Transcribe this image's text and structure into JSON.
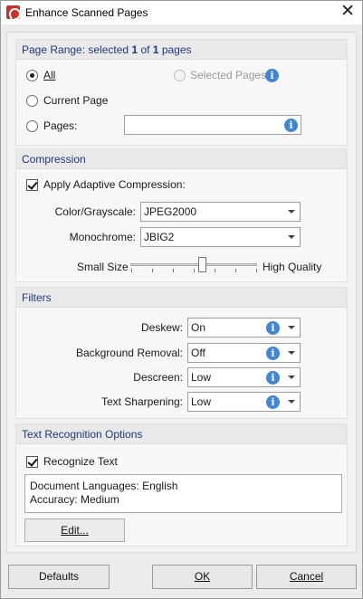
{
  "window": {
    "title": "Enhance Scanned Pages",
    "close_glyph": "✕"
  },
  "page_range": {
    "heading_prefix": "Page Range: selected ",
    "selected": "1",
    "heading_mid": " of ",
    "total": "1",
    "heading_suffix": " pages",
    "all_label": "All",
    "selected_pages_label": "Selected Pages",
    "current_page_label": "Current Page",
    "pages_label": "Pages:",
    "pages_value": "",
    "selection": "all"
  },
  "compression": {
    "heading": "Compression",
    "apply_label": "Apply Adaptive Compression:",
    "apply_checked": true,
    "color_label": "Color/Grayscale:",
    "color_value": "JPEG2000",
    "mono_label": "Monochrome:",
    "mono_value": "JBIG2",
    "small_label": "Small Size",
    "high_label": "High Quality",
    "quality_level_fraction": 0.57
  },
  "filters": {
    "heading": "Filters",
    "deskew_label": "Deskew:",
    "deskew_value": "On",
    "bg_label": "Background Removal:",
    "bg_value": "Off",
    "descreen_label": "Descreen:",
    "descreen_value": "Low",
    "sharpen_label": "Text Sharpening:",
    "sharpen_value": "Low"
  },
  "ocr": {
    "heading": "Text Recognition Options",
    "recognize_label": "Recognize Text",
    "recognize_checked": true,
    "languages_line": "Document Languages: English",
    "accuracy_line": "Accuracy: Medium",
    "edit_label": "Edit..."
  },
  "buttons": {
    "defaults": "Defaults",
    "ok": "OK",
    "cancel": "Cancel"
  },
  "icons": {
    "app": "foxit-pdf-icon",
    "info": "info-icon",
    "dropdown": "chevron-down-icon"
  },
  "colors": {
    "group_heading": "#1e3a7a",
    "info_blue": "#3f86d4",
    "app_red": "#c9332b"
  }
}
